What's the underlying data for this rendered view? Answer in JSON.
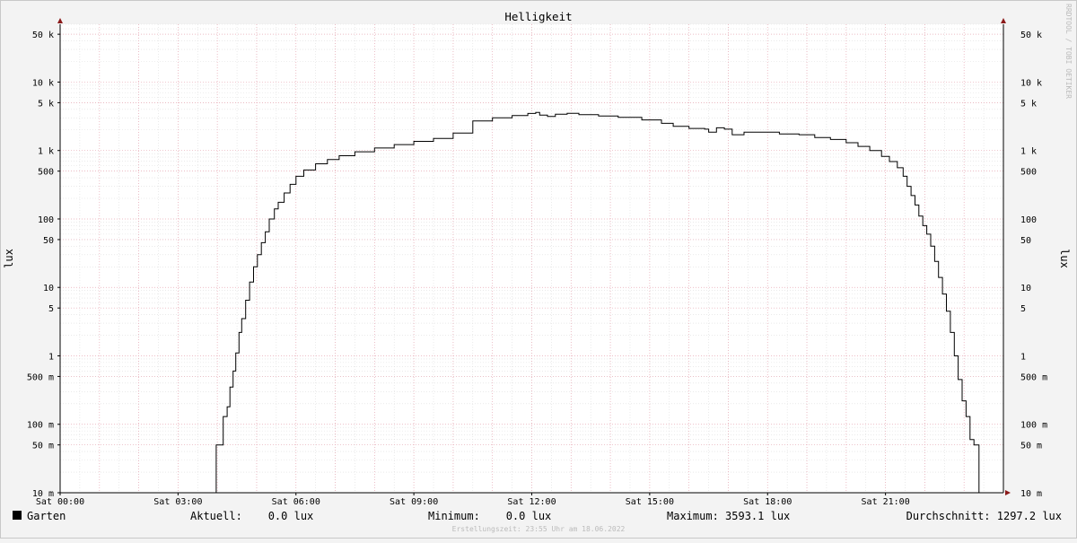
{
  "chart_data": {
    "type": "line",
    "title": "Helligkeit",
    "ylabel": "lux",
    "ylabel_right": "lux",
    "yscale": "log",
    "ylim": [
      0.01,
      70000
    ],
    "xlim_hours": [
      0,
      24
    ],
    "watermark": "RRDTOOL / TOBI OETIKER",
    "y_ticks": [
      {
        "v": 50000,
        "label": "50 k"
      },
      {
        "v": 10000,
        "label": "10 k"
      },
      {
        "v": 5000,
        "label": "5 k"
      },
      {
        "v": 1000,
        "label": "1 k"
      },
      {
        "v": 500,
        "label": "500"
      },
      {
        "v": 100,
        "label": "100"
      },
      {
        "v": 50,
        "label": "50"
      },
      {
        "v": 10,
        "label": "10"
      },
      {
        "v": 5,
        "label": "5"
      },
      {
        "v": 1,
        "label": "1"
      },
      {
        "v": 0.5,
        "label": "500 m"
      },
      {
        "v": 0.1,
        "label": "100 m"
      },
      {
        "v": 0.05,
        "label": "50 m"
      },
      {
        "v": 0.01,
        "label": "10 m"
      }
    ],
    "x_ticks": [
      {
        "h": 0,
        "label": "Sat 00:00"
      },
      {
        "h": 3,
        "label": "Sat 03:00"
      },
      {
        "h": 6,
        "label": "Sat 06:00"
      },
      {
        "h": 9,
        "label": "Sat 09:00"
      },
      {
        "h": 12,
        "label": "Sat 12:00"
      },
      {
        "h": 15,
        "label": "Sat 15:00"
      },
      {
        "h": 18,
        "label": "Sat 18:00"
      },
      {
        "h": 21,
        "label": "Sat 21:00"
      }
    ],
    "series": [
      {
        "name": "Garten",
        "color": "#000000",
        "points": [
          [
            0,
            0.01
          ],
          [
            3.95,
            0.01
          ],
          [
            3.97,
            0.05
          ],
          [
            4.1,
            0.05
          ],
          [
            4.15,
            0.13
          ],
          [
            4.25,
            0.18
          ],
          [
            4.32,
            0.35
          ],
          [
            4.4,
            0.6
          ],
          [
            4.47,
            1.1
          ],
          [
            4.55,
            2.2
          ],
          [
            4.62,
            3.5
          ],
          [
            4.72,
            6.5
          ],
          [
            4.82,
            12
          ],
          [
            4.92,
            20
          ],
          [
            5.02,
            30
          ],
          [
            5.12,
            45
          ],
          [
            5.22,
            65
          ],
          [
            5.32,
            100
          ],
          [
            5.45,
            140
          ],
          [
            5.55,
            175
          ],
          [
            5.7,
            240
          ],
          [
            5.85,
            320
          ],
          [
            6.0,
            420
          ],
          [
            6.2,
            520
          ],
          [
            6.5,
            640
          ],
          [
            6.8,
            740
          ],
          [
            7.1,
            840
          ],
          [
            7.5,
            960
          ],
          [
            8.0,
            1090
          ],
          [
            8.5,
            1220
          ],
          [
            9.0,
            1360
          ],
          [
            9.5,
            1500
          ],
          [
            10.0,
            1800
          ],
          [
            10.5,
            2700
          ],
          [
            11.0,
            3000
          ],
          [
            11.5,
            3250
          ],
          [
            11.9,
            3480
          ],
          [
            12.1,
            3593
          ],
          [
            12.2,
            3300
          ],
          [
            12.4,
            3150
          ],
          [
            12.6,
            3400
          ],
          [
            12.9,
            3500
          ],
          [
            13.2,
            3350
          ],
          [
            13.7,
            3200
          ],
          [
            14.2,
            3050
          ],
          [
            14.8,
            2800
          ],
          [
            15.3,
            2500
          ],
          [
            15.6,
            2250
          ],
          [
            16.0,
            2100
          ],
          [
            16.4,
            2050
          ],
          [
            16.5,
            1850
          ],
          [
            16.7,
            2150
          ],
          [
            16.9,
            2050
          ],
          [
            17.1,
            1700
          ],
          [
            17.4,
            1850
          ],
          [
            17.8,
            1850
          ],
          [
            18.3,
            1750
          ],
          [
            18.8,
            1700
          ],
          [
            19.2,
            1550
          ],
          [
            19.6,
            1450
          ],
          [
            20.0,
            1300
          ],
          [
            20.3,
            1150
          ],
          [
            20.6,
            1000
          ],
          [
            20.9,
            820
          ],
          [
            21.1,
            690
          ],
          [
            21.3,
            560
          ],
          [
            21.45,
            420
          ],
          [
            21.55,
            300
          ],
          [
            21.65,
            220
          ],
          [
            21.75,
            160
          ],
          [
            21.85,
            110
          ],
          [
            21.95,
            80
          ],
          [
            22.05,
            60
          ],
          [
            22.15,
            40
          ],
          [
            22.25,
            24
          ],
          [
            22.35,
            14
          ],
          [
            22.45,
            8
          ],
          [
            22.55,
            4.5
          ],
          [
            22.65,
            2.2
          ],
          [
            22.75,
            1.0
          ],
          [
            22.85,
            0.45
          ],
          [
            22.95,
            0.22
          ],
          [
            23.05,
            0.13
          ],
          [
            23.15,
            0.06
          ],
          [
            23.25,
            0.05
          ],
          [
            23.35,
            0.05
          ],
          [
            23.38,
            0.01
          ],
          [
            24,
            0.01
          ]
        ]
      }
    ]
  },
  "legend": {
    "series_name": "Garten",
    "current": "Aktuell:    0.0 lux",
    "minimum": "Minimum:    0.0 lux",
    "maximum": "Maximum: 3593.1 lux",
    "average": "Durchschnitt: 1297.2 lux"
  },
  "footer": "Erstellungszeit: 23:55 Uhr am 18.06.2022"
}
